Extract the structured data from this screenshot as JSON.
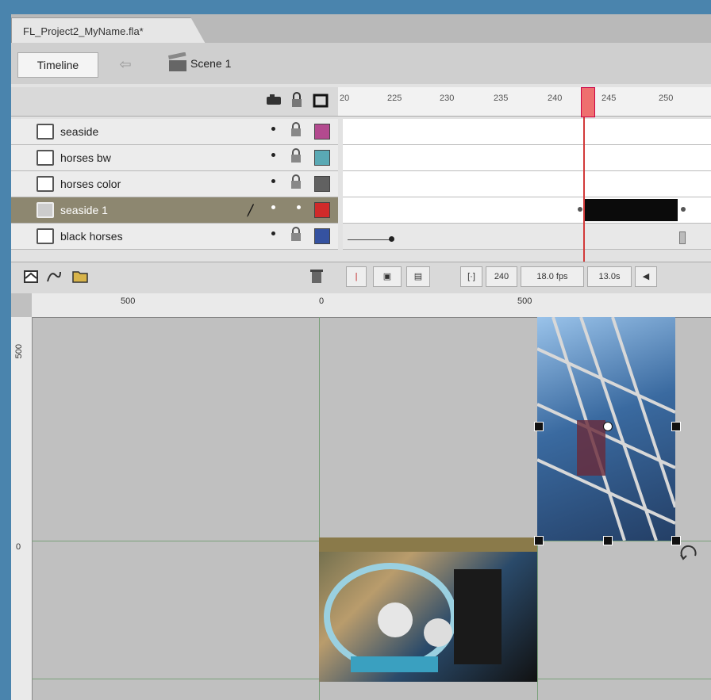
{
  "document_tab": {
    "title": "FL_Project2_MyName.fla*"
  },
  "toolbar": {
    "timeline_label": "Timeline",
    "back_arrow": "⇦",
    "scene_label": "Scene 1"
  },
  "timeline": {
    "frame_ticks": [
      "20",
      "225",
      "230",
      "235",
      "240",
      "245",
      "250"
    ],
    "playhead_frame": "240",
    "layers": [
      {
        "name": "seaside",
        "color": "#b34a8f",
        "selected": false
      },
      {
        "name": "horses bw",
        "color": "#5aa9b4",
        "selected": false
      },
      {
        "name": "horses color",
        "color": "#616161",
        "selected": false
      },
      {
        "name": "seaside 1",
        "color": "#d02a2a",
        "selected": true
      },
      {
        "name": "black horses",
        "color": "#3552a0",
        "selected": false
      }
    ],
    "footer": {
      "frame": "240",
      "fps": "18.0 fps",
      "time": "13.0s"
    }
  },
  "stage": {
    "hruler_labels": [
      "500",
      "0",
      "500"
    ],
    "vruler_labels": [
      "500",
      "0"
    ]
  }
}
